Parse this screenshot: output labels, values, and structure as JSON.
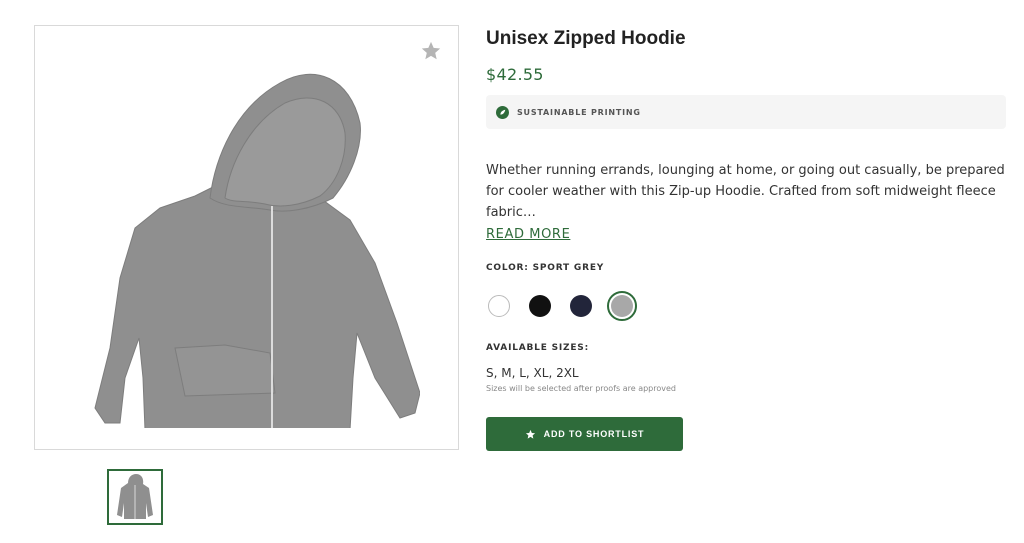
{
  "product": {
    "title": "Unisex Zipped Hoodie",
    "price": "$42.55",
    "badge": {
      "icon": "leaf-icon",
      "label": "SUSTAINABLE PRINTING"
    },
    "description": "Whether running errands, lounging at home, or going out casually, be prepared for cooler weather with this Zip-up Hoodie. Crafted from soft midweight fleece fabric…",
    "read_more": "READ MORE",
    "color": {
      "label": "COLOR:",
      "value": "SPORT GREY"
    },
    "swatches": [
      {
        "name": "white",
        "color": "#ffffff",
        "selected": false
      },
      {
        "name": "black",
        "color": "#111111",
        "selected": false
      },
      {
        "name": "navy",
        "color": "#22253a",
        "selected": false
      },
      {
        "name": "sport grey",
        "color": "#a8a8a8",
        "selected": true
      }
    ],
    "sizes": {
      "heading": "AVAILABLE SIZES:",
      "value": "S, M, L, XL, 2XL",
      "note": "Sizes will be selected after proofs are approved"
    },
    "shortlist_button": {
      "icon": "star-icon",
      "label": "ADD TO SHORTLIST"
    },
    "favorite_icon": "star-icon"
  },
  "colors": {
    "accent": "#2e6b3a",
    "badge_bg": "#f5f5f5",
    "hoodie": "#8f8f8f"
  }
}
